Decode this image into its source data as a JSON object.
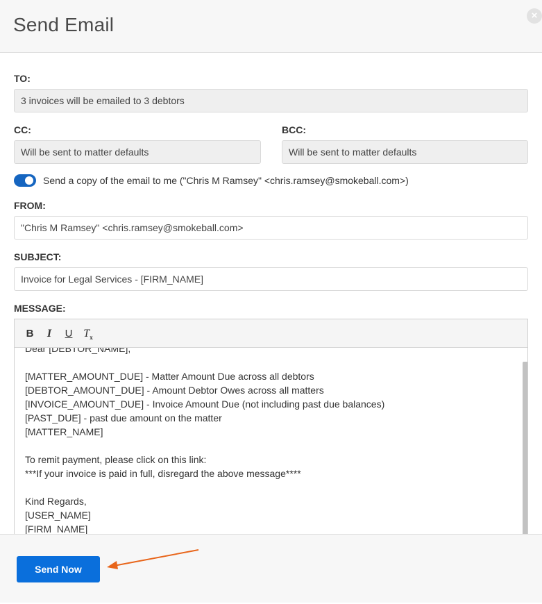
{
  "dialog": {
    "title": "Send Email",
    "close_icon": "close-icon"
  },
  "to": {
    "label": "TO:",
    "value": "3 invoices will be emailed to 3 debtors"
  },
  "cc": {
    "label": "CC:",
    "value": "Will be sent to matter defaults"
  },
  "bcc": {
    "label": "BCC:",
    "value": "Will be sent to matter defaults"
  },
  "copy_to_me": {
    "enabled": true,
    "label": "Send a copy of the email to me (\"Chris M Ramsey\" <chris.ramsey@smokeball.com>)"
  },
  "from": {
    "label": "FROM:",
    "value": "\"Chris M Ramsey\" <chris.ramsey@smokeball.com>"
  },
  "subject": {
    "label": "SUBJECT:",
    "value": "Invoice for Legal Services - [FIRM_NAME]"
  },
  "message": {
    "label": "MESSAGE:",
    "toolbar": {
      "bold": "B",
      "italic": "I",
      "underline": "U",
      "clear_format": "T",
      "clear_format_sub": "x"
    },
    "lines": [
      "Dear [DEBTOR_NAME],",
      "",
      "[MATTER_AMOUNT_DUE] - Matter Amount Due across all debtors",
      "[DEBTOR_AMOUNT_DUE] - Amount Debtor Owes across all matters",
      "[INVOICE_AMOUNT_DUE] - Invoice Amount Due (not including past due balances)",
      "[PAST_DUE] - past due amount on the matter",
      "[MATTER_NAME]",
      "",
      "To remit payment, please click on this link:",
      "***If your invoice is paid in full, disregard the above message****",
      "",
      "Kind Regards,",
      "[USER_NAME]",
      "[FIRM_NAME]"
    ]
  },
  "footer": {
    "send_label": "Send Now"
  },
  "colors": {
    "accent": "#0a6fdc",
    "toggle": "#1565c0",
    "annotation_arrow": "#e8651a"
  }
}
